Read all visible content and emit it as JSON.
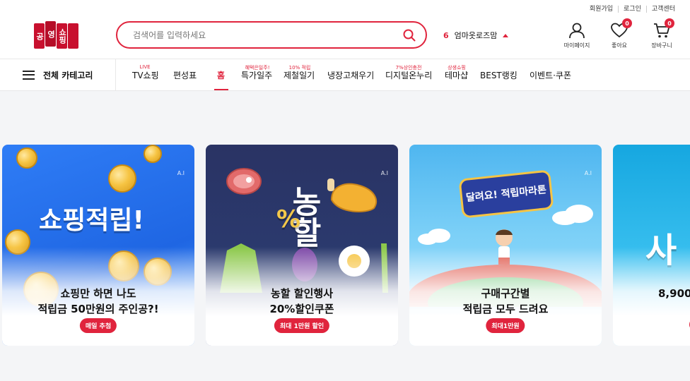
{
  "util_links": [
    "회원가입",
    "로그인",
    "고객센터"
  ],
  "logo": {
    "chars": [
      "공",
      "영",
      "쇼핑"
    ]
  },
  "search": {
    "placeholder": "검색어를 입력하세요"
  },
  "rank": {
    "number": "6",
    "keyword": "엄마옷로즈맘"
  },
  "header_icons": [
    {
      "icon": "person-icon",
      "label": "마이페이지"
    },
    {
      "icon": "heart-icon",
      "label": "좋아요",
      "count": "0"
    },
    {
      "icon": "cart-icon",
      "label": "장바구니",
      "count": "0"
    }
  ],
  "nav": {
    "category_label": "전체 카테고리",
    "items": [
      {
        "label": "TV쇼핑",
        "sup": "LIVE"
      },
      {
        "label": "편성표",
        "sup": ""
      },
      {
        "label": "홈",
        "sup": "",
        "active": true
      },
      {
        "label": "특가일주",
        "sup": "혜택은일주!"
      },
      {
        "label": "제철일기",
        "sup": "10% 적립"
      },
      {
        "label": "냉장고채우기",
        "sup": ""
      },
      {
        "label": "디지털온누리",
        "sup": "7%상인충전"
      },
      {
        "label": "테마샵",
        "sup": "상생쇼핑"
      },
      {
        "label": "BEST랭킹",
        "sup": ""
      },
      {
        "label": "이벤트·쿠폰",
        "sup": ""
      }
    ]
  },
  "cards": [
    {
      "art_text": "쇼핑적립!",
      "ai": "A.I",
      "line1": "쇼핑만 하면 나도",
      "line2": "적립금 50만원의 주인공?!",
      "pill": "매일 추첨"
    },
    {
      "art_text": "농할",
      "ai": "A.I",
      "line1": "농할 할인행사",
      "line2": "20%할인쿠폰",
      "pill": "최대 1만원 할인"
    },
    {
      "art_text": "달려요! 적립마라톤",
      "ai": "A.I",
      "line1": "구매구간별",
      "line2": "적립금 모두 드려요",
      "pill": "최대1만원"
    },
    {
      "art_text": "사",
      "line1": "",
      "line2": "8,900"
    }
  ],
  "colors": {
    "accent": "#e0243d",
    "background": "#f4f5f7"
  }
}
